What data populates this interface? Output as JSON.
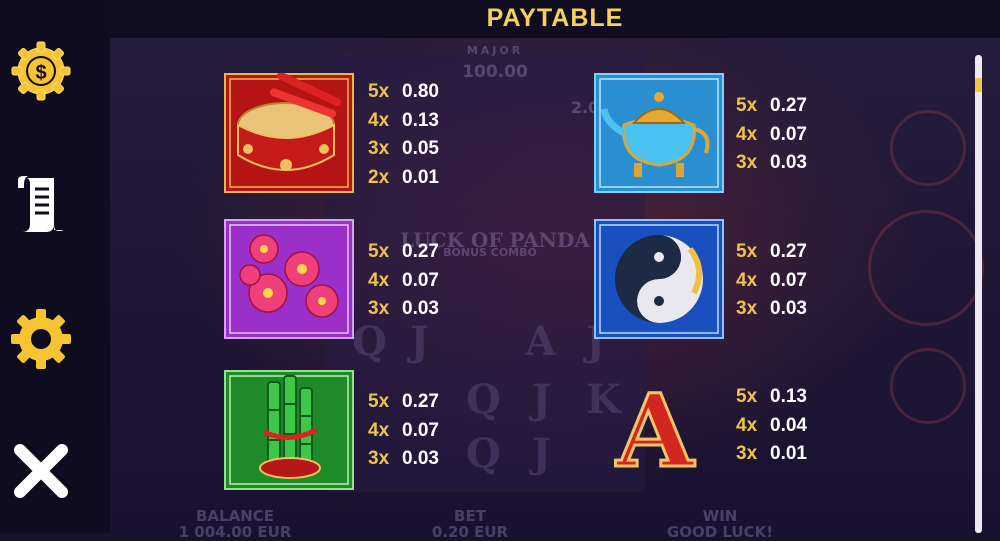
{
  "title": "PAYTABLE",
  "colors": {
    "accent": "#f5d15a",
    "multiplier": "#f0c44a",
    "value": "#ffffff"
  },
  "sidebar": {
    "buttons": [
      {
        "name": "coins-icon"
      },
      {
        "name": "rules-icon"
      },
      {
        "name": "settings-icon"
      },
      {
        "name": "close-icon"
      }
    ]
  },
  "background": {
    "jackpot_major_label": "MAJOR",
    "jackpot_major_value": "100.00",
    "jackpot_minor_value": "2.0",
    "game_title": "LUCK OF PANDA",
    "game_subtitle": "BONUS COMBO",
    "balance_label": "BALANCE",
    "balance_value": "1 004.00 EUR",
    "bet_label": "BET",
    "bet_value": "0.20 EUR",
    "win_label": "WIN",
    "win_value": "GOOD LUCK!"
  },
  "symbols": [
    {
      "id": "drum",
      "name": "drum-symbol",
      "pays": [
        {
          "mult": "5x",
          "amount": "0.80"
        },
        {
          "mult": "4x",
          "amount": "0.13"
        },
        {
          "mult": "3x",
          "amount": "0.05"
        },
        {
          "mult": "2x",
          "amount": "0.01"
        }
      ]
    },
    {
      "id": "teapot",
      "name": "teapot-symbol",
      "pays": [
        {
          "mult": "5x",
          "amount": "0.27"
        },
        {
          "mult": "4x",
          "amount": "0.07"
        },
        {
          "mult": "3x",
          "amount": "0.03"
        }
      ]
    },
    {
      "id": "flowers",
      "name": "flowers-symbol",
      "pays": [
        {
          "mult": "5x",
          "amount": "0.27"
        },
        {
          "mult": "4x",
          "amount": "0.07"
        },
        {
          "mult": "3x",
          "amount": "0.03"
        }
      ]
    },
    {
      "id": "koi",
      "name": "koi-yinyang-symbol",
      "pays": [
        {
          "mult": "5x",
          "amount": "0.27"
        },
        {
          "mult": "4x",
          "amount": "0.07"
        },
        {
          "mult": "3x",
          "amount": "0.03"
        }
      ]
    },
    {
      "id": "bamboo",
      "name": "bamboo-symbol",
      "pays": [
        {
          "mult": "5x",
          "amount": "0.27"
        },
        {
          "mult": "4x",
          "amount": "0.07"
        },
        {
          "mult": "3x",
          "amount": "0.03"
        }
      ]
    },
    {
      "id": "letter-a",
      "name": "letter-a-symbol",
      "letter": "A",
      "pays": [
        {
          "mult": "5x",
          "amount": "0.13"
        },
        {
          "mult": "4x",
          "amount": "0.04"
        },
        {
          "mult": "3x",
          "amount": "0.01"
        }
      ]
    }
  ]
}
